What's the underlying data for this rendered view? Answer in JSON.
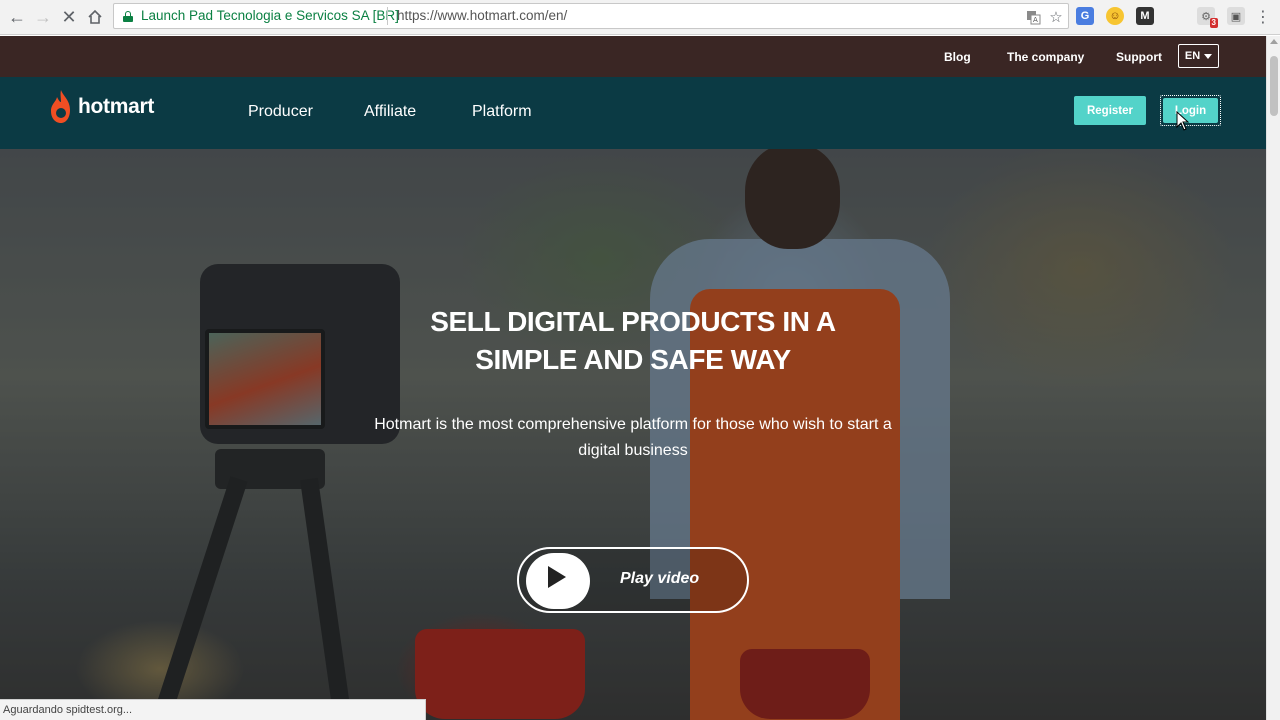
{
  "browser": {
    "certificate": "Launch Pad Tecnologia e Servicos SA [BR]",
    "url": "https://www.hotmart.com/en/",
    "extension_badge": "3",
    "status_text": "Aguardando spidtest.org..."
  },
  "topbar": {
    "links": [
      "Blog",
      "The company",
      "Support"
    ],
    "language": "EN"
  },
  "header": {
    "logo_text": "hotmart",
    "nav": [
      "Producer",
      "Affiliate",
      "Platform"
    ],
    "register_label": "Register",
    "login_label": "Login"
  },
  "hero": {
    "title": "SELL DIGITAL PRODUCTS IN A SIMPLE AND SAFE WAY",
    "subtitle": "Hotmart is the most comprehensive platform for those who wish to start a digital business",
    "play_label": "Play video"
  },
  "colors": {
    "topbar_bg": "#3a2624",
    "header_bg": "#0b3a44",
    "accent_teal": "#53d3c9",
    "brand_red": "#f04e23"
  },
  "icons": [
    "back-icon",
    "forward-icon",
    "reload-icon",
    "home-icon",
    "lock-icon",
    "translate-icon",
    "star-icon",
    "play-icon"
  ]
}
